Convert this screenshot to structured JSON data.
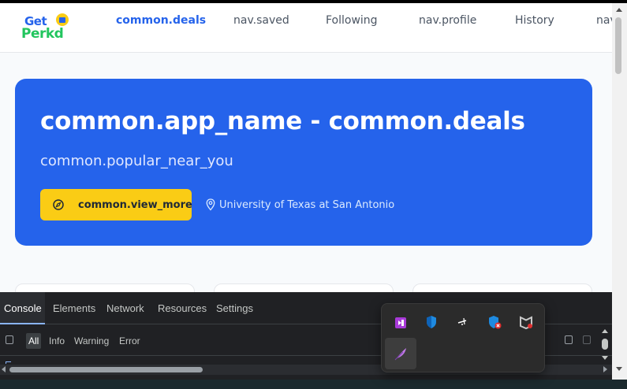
{
  "logo": {
    "line1": "Get",
    "line2": "Perkd"
  },
  "nav": {
    "items": [
      {
        "label": "common.deals",
        "active": true
      },
      {
        "label": "nav.saved",
        "active": false
      },
      {
        "label": "Following",
        "active": false
      },
      {
        "label": "nav.profile",
        "active": false
      },
      {
        "label": "History",
        "active": false
      },
      {
        "label": "nav",
        "active": false
      }
    ]
  },
  "hero": {
    "title": "common.app_name - common.deals",
    "subtitle": "common.popular_near_you",
    "button_label": "common.view_more",
    "location": "University of Texas at San Antonio"
  },
  "devtools": {
    "tabs": [
      "Console",
      "Elements",
      "Network",
      "Resources",
      "Settings"
    ],
    "active_tab": "Console",
    "levels": [
      "All",
      "Info",
      "Warning",
      "Error"
    ]
  },
  "tray": {
    "icons": [
      "visual-studio-icon",
      "defender-shield-icon",
      "pen-tablet-icon",
      "security-shield-alert-icon",
      "mcafee-icon",
      "feather-app-icon"
    ]
  },
  "colors": {
    "accent": "#2563eb",
    "cta": "#facc15",
    "devtools_bg": "#202124"
  }
}
